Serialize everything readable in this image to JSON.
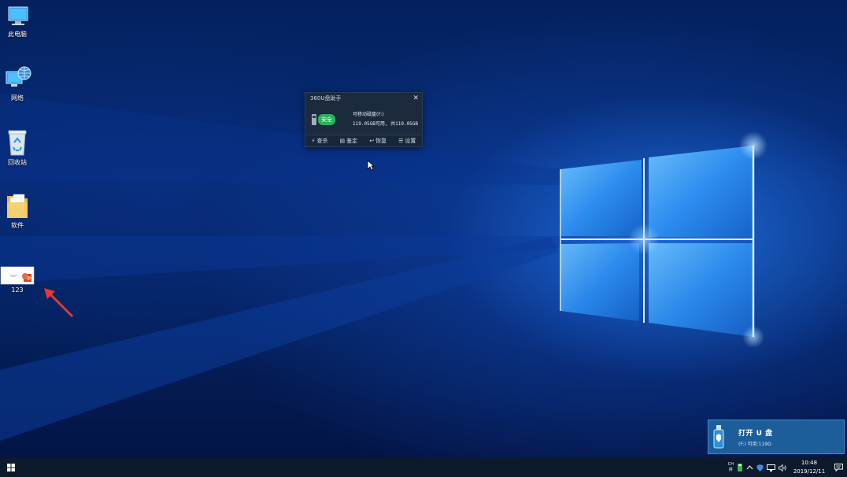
{
  "desktop": {
    "icons": [
      {
        "label": "此电脑",
        "icon": "this-pc-icon"
      },
      {
        "label": "网络",
        "icon": "network-icon"
      },
      {
        "label": "回收站",
        "icon": "recycle-bin-icon"
      },
      {
        "label": "软件",
        "icon": "folder-icon"
      },
      {
        "label": "123",
        "icon": "powerpoint-file-icon"
      }
    ]
  },
  "popup": {
    "title": "360U盘助手",
    "status_badge": "安全",
    "drive_name": "可移动磁盘(F:)",
    "capacity": "119.05GB可用, 共119.05GB",
    "toolbar": [
      {
        "label": "查杀",
        "icon": "lightning-icon"
      },
      {
        "label": "鉴定",
        "icon": "chip-icon"
      },
      {
        "label": "恢复",
        "icon": "restore-icon"
      },
      {
        "label": "设置",
        "icon": "settings-list-icon"
      }
    ]
  },
  "toast": {
    "title": "打开 U 盘",
    "subtitle": "(F:)  可用:119G"
  },
  "taskbar": {
    "ime_top": "CH",
    "ime_bottom": "拼",
    "time": "10:48",
    "date": "2019/12/11"
  },
  "colors": {
    "accent": "#1c5e9a",
    "safe_green": "#29b25a",
    "arrow_red": "#e8372b",
    "taskbar": "#0c1a2c"
  }
}
